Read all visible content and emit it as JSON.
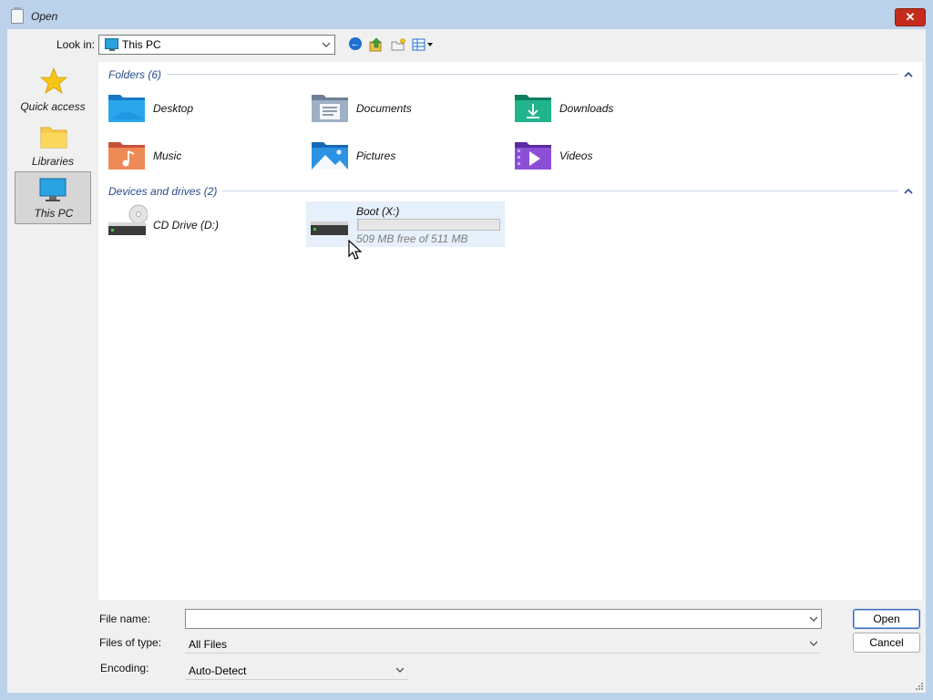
{
  "window": {
    "title": "Open",
    "close_glyph": "✕"
  },
  "toolbar": {
    "look_in_label": "Look in:",
    "look_in_value": "This PC",
    "icons": [
      "back-icon",
      "up-folder-icon",
      "new-folder-icon",
      "view-menu-icon"
    ]
  },
  "places": [
    {
      "label": "Quick access",
      "icon": "star-icon"
    },
    {
      "label": "Libraries",
      "icon": "libraries-folder-icon"
    },
    {
      "label": "This PC",
      "icon": "monitor-icon",
      "selected": true
    }
  ],
  "groups": {
    "folders": {
      "title": "Folders (6)",
      "items": [
        {
          "label": "Desktop",
          "icon": "desktop-folder-icon",
          "color": "#1d8de0"
        },
        {
          "label": "Documents",
          "icon": "documents-folder-icon",
          "color": "#7b8fa6"
        },
        {
          "label": "Downloads",
          "icon": "downloads-folder-icon",
          "color": "#1aa37e"
        },
        {
          "label": "Music",
          "icon": "music-folder-icon",
          "color": "#e0703f"
        },
        {
          "label": "Pictures",
          "icon": "pictures-folder-icon",
          "color": "#1f86d6"
        },
        {
          "label": "Videos",
          "icon": "videos-folder-icon",
          "color": "#7a3fc4"
        }
      ]
    },
    "drives": {
      "title": "Devices and drives (2)",
      "items": [
        {
          "label": "CD Drive (D:)",
          "icon": "cd-drive-icon"
        },
        {
          "label": "Boot (X:)",
          "icon": "hard-drive-icon",
          "free_text": "509 MB free of 511 MB",
          "used_fraction": 0.004
        }
      ]
    }
  },
  "form": {
    "file_name_label": "File name:",
    "file_name_value": "",
    "files_of_type_label": "Files of type:",
    "files_of_type_value": "All Files",
    "encoding_label": "Encoding:",
    "encoding_value": "Auto-Detect"
  },
  "buttons": {
    "open": "Open",
    "cancel": "Cancel"
  },
  "colors": {
    "accent": "#284c8c",
    "titlebar": "#bcd1ea",
    "close": "#c42b1c",
    "selection": "#e5f0fb"
  }
}
